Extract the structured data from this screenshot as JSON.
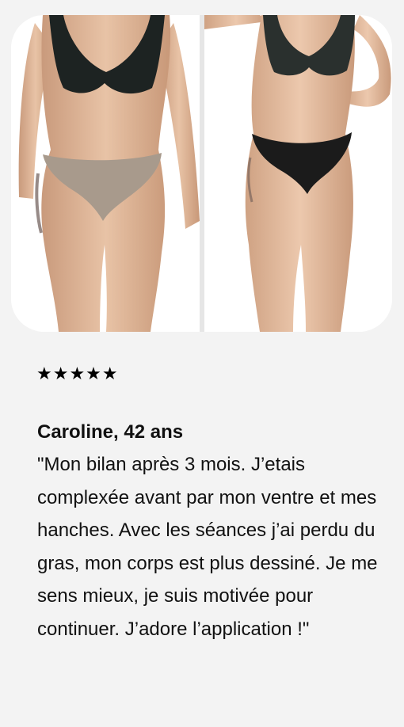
{
  "testimonial": {
    "rating_stars": "★★★★★",
    "rating_value": 5,
    "rating_max": 5,
    "author": "Caroline, 42 ans",
    "quote": "\"Mon bilan après 3 mois. J’etais complexée avant par mon ventre et mes hanches. Avec les séances j’ai perdu du gras, mon corps est plus dessiné. Je me sens mieux, je suis motivée pour continuer. J’adore l’application !\""
  },
  "colors": {
    "background": "#f3f3f3",
    "card": "#ffffff",
    "text": "#111111",
    "skin": "#e2bb9c",
    "swimsuit_top": "#1d2322",
    "swimsuit_bottom_before": "#a89a8c",
    "swimsuit_bottom_after": "#1b1b1b"
  }
}
